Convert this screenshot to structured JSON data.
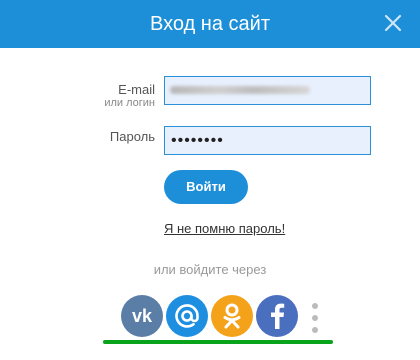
{
  "dialog": {
    "title": "Вход на сайт",
    "accent_color": "#1d8fd8",
    "close_icon": "close-icon"
  },
  "form": {
    "login_label": "E-mail",
    "login_sublabel": "или логин",
    "password_label": "Пароль",
    "password_value": "••••••••",
    "submit_label": "Войти",
    "forgot_link": "Я не помню пароль!"
  },
  "social": {
    "or_text": "или войдите через",
    "providers": [
      {
        "name": "vk-icon",
        "color": "#5b7ea6"
      },
      {
        "name": "mail-at-icon",
        "color": "#1e8ee0"
      },
      {
        "name": "odnoklassniki-icon",
        "color": "#f5a21b"
      },
      {
        "name": "facebook-icon",
        "color": "#4a6fbf"
      }
    ],
    "more_icon": "more-vertical-icon",
    "highlight_color": "#0aa31c"
  }
}
